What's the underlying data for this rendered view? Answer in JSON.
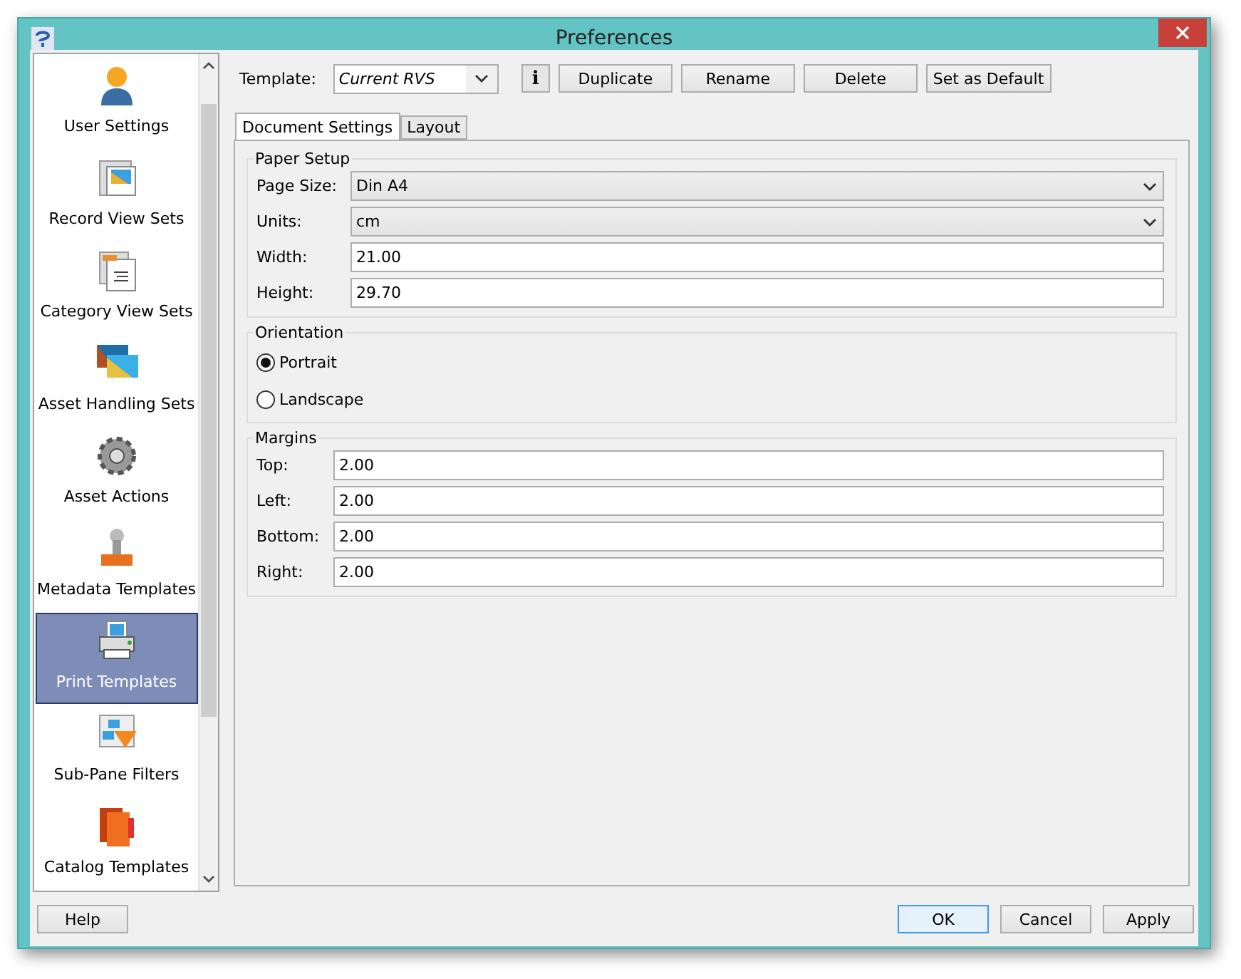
{
  "window": {
    "title": "Preferences"
  },
  "sidebar": {
    "items": [
      {
        "label": "User Settings",
        "selected": false
      },
      {
        "label": "Record View Sets",
        "selected": false
      },
      {
        "label": "Category View Sets",
        "selected": false
      },
      {
        "label": "Asset Handling Sets",
        "selected": false
      },
      {
        "label": "Asset Actions",
        "selected": false
      },
      {
        "label": "Metadata Templates",
        "selected": false
      },
      {
        "label": "Print Templates",
        "selected": true
      },
      {
        "label": "Sub-Pane Filters",
        "selected": false
      },
      {
        "label": "Catalog Templates",
        "selected": false
      }
    ]
  },
  "toolbar": {
    "template_label": "Template:",
    "template_value": "Current RVS",
    "info": "i",
    "buttons": [
      "Duplicate",
      "Rename",
      "Delete",
      "Set as Default"
    ]
  },
  "tabs": [
    {
      "label": "Document Settings",
      "selected": true
    },
    {
      "label": "Layout",
      "selected": false
    }
  ],
  "paper_setup": {
    "title": "Paper Setup",
    "fields": [
      {
        "kind": "select",
        "label": "Page Size:",
        "value": "Din A4"
      },
      {
        "kind": "select",
        "label": "Units:",
        "value": "cm"
      },
      {
        "kind": "text",
        "label": "Width:",
        "value": "21.00"
      },
      {
        "kind": "text",
        "label": "Height:",
        "value": "29.70"
      }
    ]
  },
  "orientation": {
    "title": "Orientation",
    "options": [
      {
        "label": "Portrait",
        "selected": true
      },
      {
        "label": "Landscape",
        "selected": false
      }
    ]
  },
  "margins": {
    "title": "Margins",
    "fields": [
      {
        "kind": "text",
        "label": "Top:",
        "value": "2.00"
      },
      {
        "kind": "text",
        "label": "Left:",
        "value": "2.00"
      },
      {
        "kind": "text",
        "label": "Bottom:",
        "value": "2.00"
      },
      {
        "kind": "text",
        "label": "Right:",
        "value": "2.00"
      }
    ]
  },
  "footer": {
    "help": "Help",
    "buttons": [
      "OK",
      "Cancel",
      "Apply"
    ]
  }
}
